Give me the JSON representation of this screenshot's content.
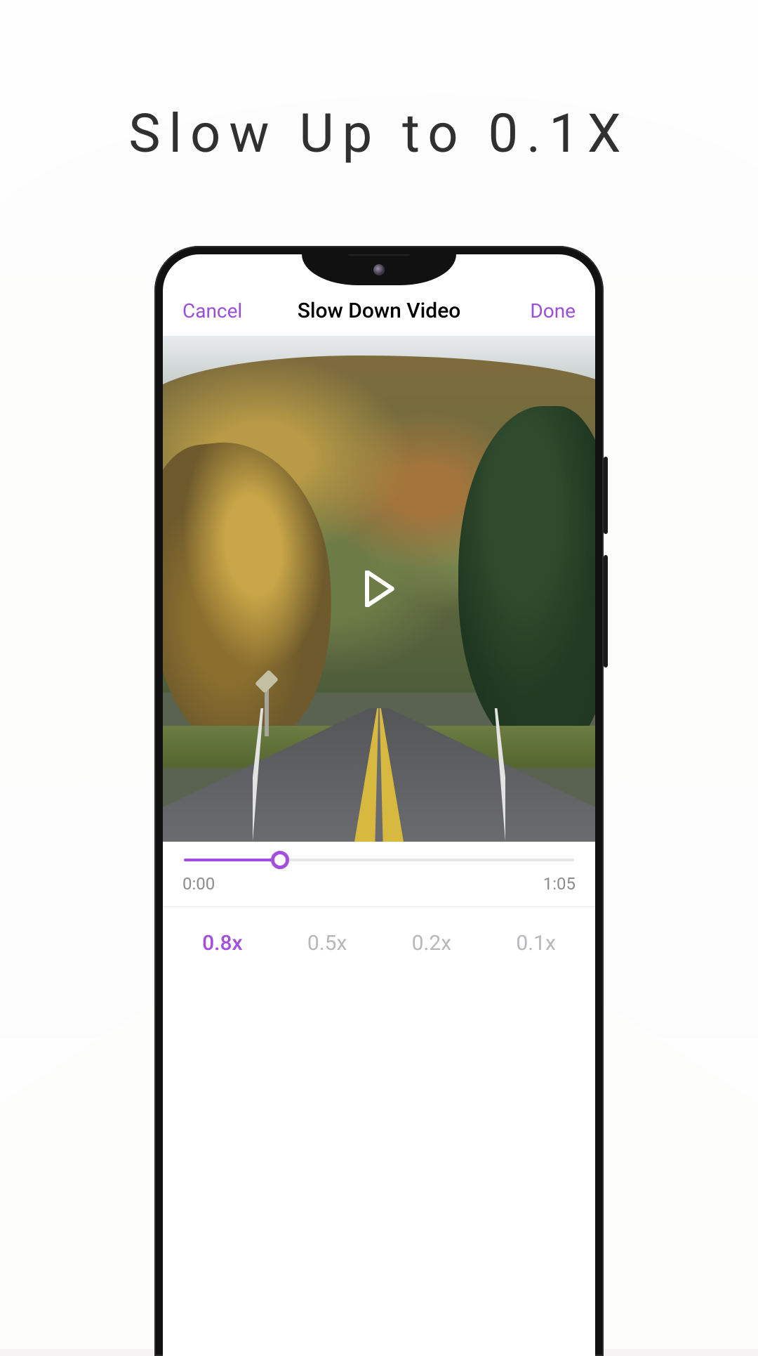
{
  "promo": {
    "headline": "Slow Up to 0.1X"
  },
  "colors": {
    "accent": "#a24fe0"
  },
  "topbar": {
    "cancel": "Cancel",
    "title": "Slow Down Video",
    "done": "Done"
  },
  "player": {
    "icon": "play-icon"
  },
  "scrubber": {
    "progress_percent": 24.6,
    "current_time": "0:00",
    "duration": "1:05"
  },
  "speeds": {
    "options": [
      "0.8x",
      "0.5x",
      "0.2x",
      "0.1x"
    ],
    "selected_index": 0
  }
}
